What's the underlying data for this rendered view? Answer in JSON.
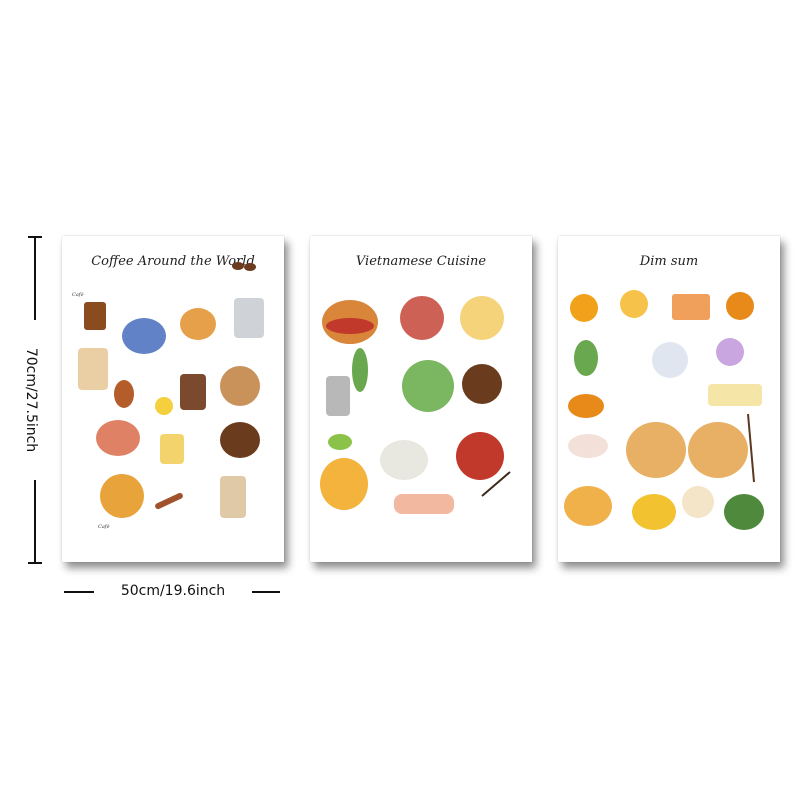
{
  "dimensions": {
    "height_label": "70cm/27.5inch",
    "width_label": "50cm/19.6inch"
  },
  "panels": [
    {
      "title": "Coffee Around the World",
      "accent": "#c98a3a"
    },
    {
      "title": "Vietnamese Cuisine",
      "accent": "#d94a2a"
    },
    {
      "title": "Dim sum",
      "accent": "#f2a21a"
    }
  ]
}
